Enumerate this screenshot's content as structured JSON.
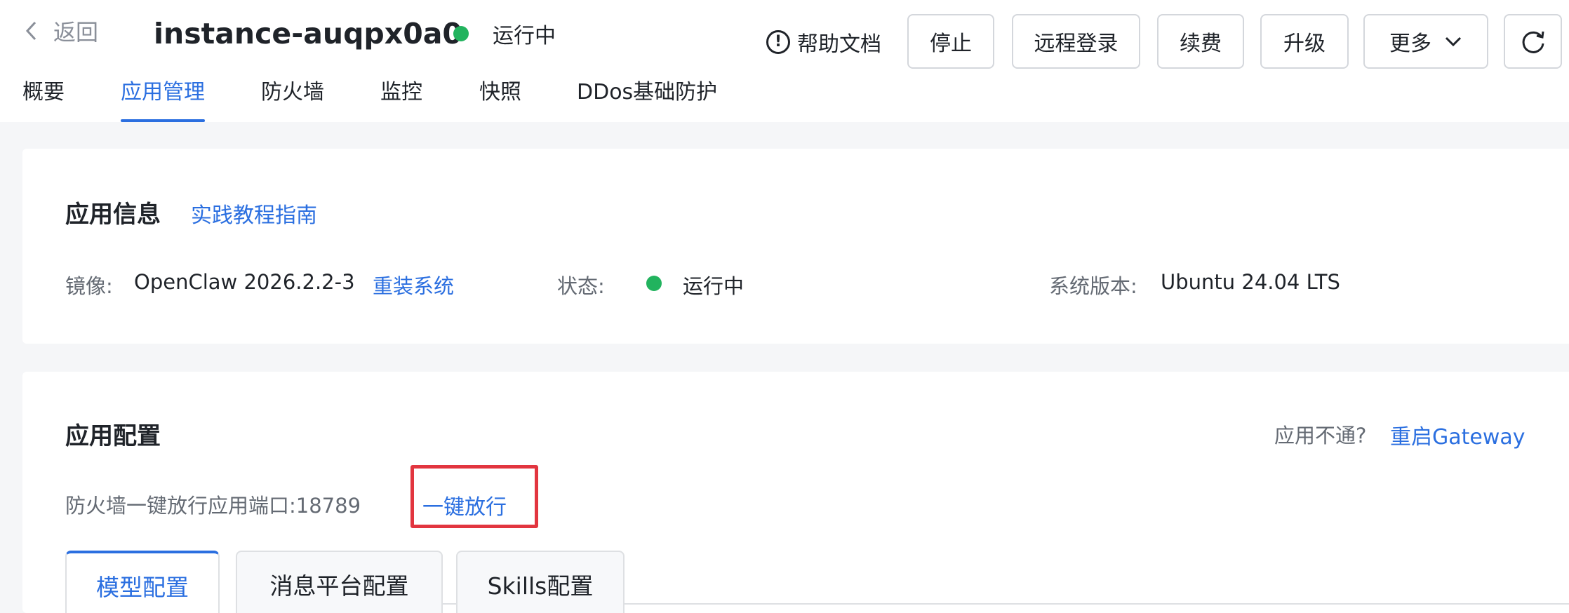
{
  "header": {
    "back_label": "返回",
    "instance_name": "instance-auqpx0a0",
    "status_text": "运行中",
    "status_color": "#22b35e",
    "help_label": "帮助文档",
    "help_icon": "exclamation-circle-icon",
    "buttons": {
      "stop": "停止",
      "remote_login": "远程登录",
      "renew": "续费",
      "upgrade": "升级",
      "more": "更多"
    },
    "refresh_icon": "refresh-icon"
  },
  "tabs": [
    {
      "label": "概要"
    },
    {
      "label": "应用管理",
      "active": true
    },
    {
      "label": "防火墙"
    },
    {
      "label": "监控"
    },
    {
      "label": "快照"
    },
    {
      "label": "DDos基础防护"
    }
  ],
  "app_info": {
    "title": "应用信息",
    "guide_link": "实践教程指南",
    "image_label": "镜像:",
    "image_value": "OpenClaw 2026.2.2-3",
    "reinstall_link": "重装系统",
    "status_label": "状态:",
    "status_value": "运行中",
    "os_label": "系统版本:",
    "os_value": "Ubuntu 24.04 LTS"
  },
  "app_config": {
    "title": "应用配置",
    "unreachable_label": "应用不通?",
    "restart_link": "重启Gateway",
    "firewall_text": "防火墙一键放行应用端口:18789",
    "allow_link": "一键放行",
    "tabs": [
      "模型配置",
      "消息平台配置",
      "Skills配置"
    ],
    "active_tab": "模型配置"
  },
  "colors": {
    "accent": "#2b6fe0",
    "running": "#22b35e",
    "highlight_box": "#e2353f"
  }
}
